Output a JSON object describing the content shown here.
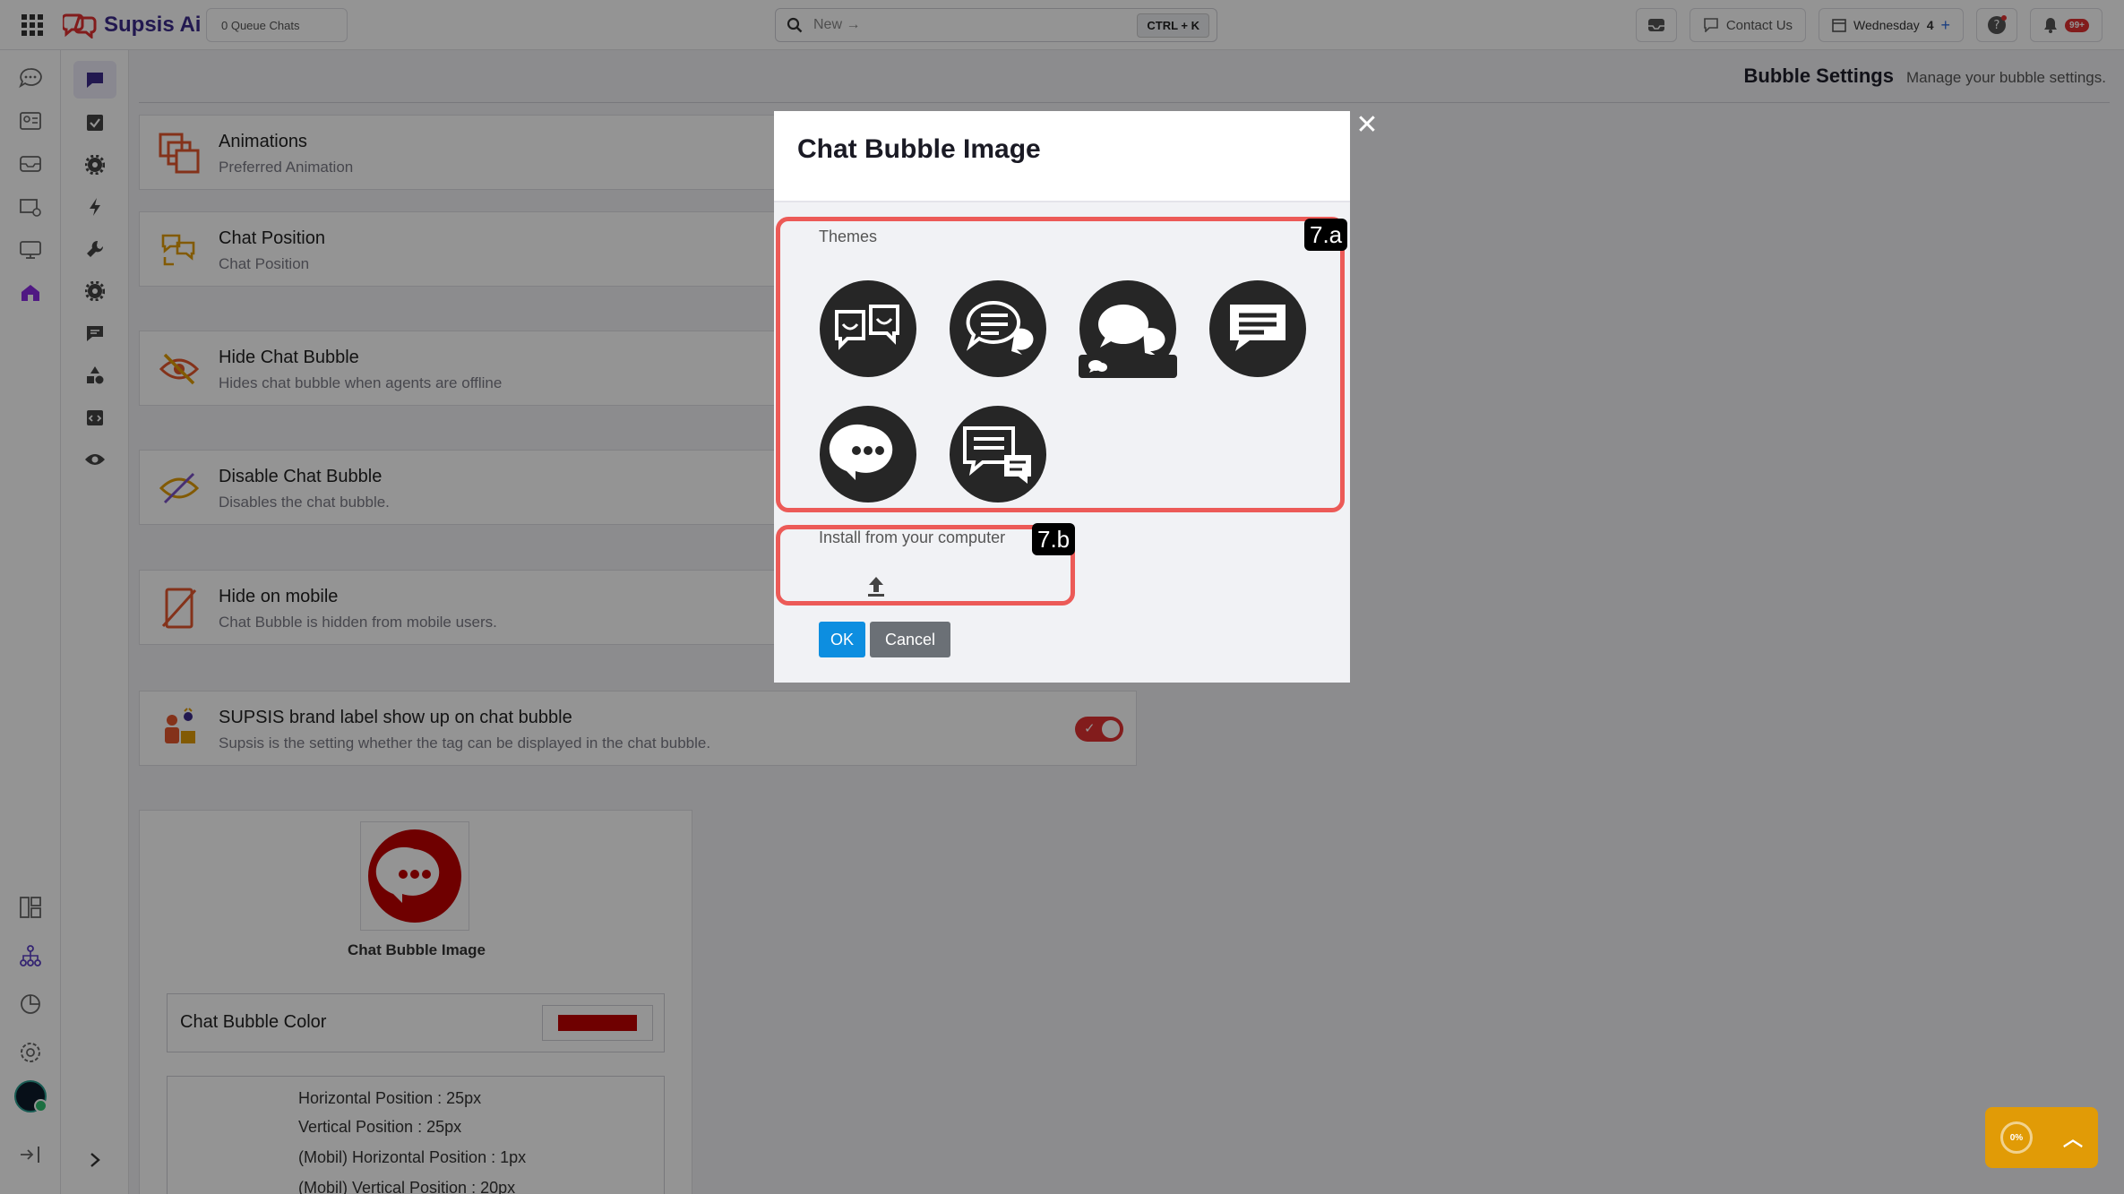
{
  "app": {
    "brand": "Supsis Ai",
    "queue": "0 Queue Chats"
  },
  "search": {
    "placeholder": "New →",
    "shortcut": "CTRL + K"
  },
  "topbar": {
    "contact": "Contact Us",
    "day": "Wednesday",
    "day_num": "4",
    "notif_count": "99+"
  },
  "page": {
    "title": "Bubble Settings",
    "subtitle": "Manage your bubble settings."
  },
  "settings": [
    {
      "title": "Animations",
      "desc": "Preferred Animation",
      "icon": "animation-icon"
    },
    {
      "title": "Chat Position",
      "desc": "Chat Position",
      "icon": "position-icon"
    },
    {
      "title": "Hide Chat Bubble",
      "desc": "Hides chat bubble when agents are offline",
      "icon": "eye-off-icon"
    },
    {
      "title": "Disable Chat Bubble",
      "desc": "Disables the chat bubble.",
      "icon": "disable-icon"
    },
    {
      "title": "Hide on mobile",
      "desc": "Chat Bubble is hidden from mobile users.",
      "icon": "mobile-off-icon"
    },
    {
      "title": "SUPSIS brand label show up on chat bubble",
      "desc": "Supsis is the setting whether the tag can be displayed in the chat bubble.",
      "icon": "brand-icon",
      "toggle_on": true
    }
  ],
  "bubble": {
    "image_caption": "Chat Bubble Image",
    "color_label": "Chat Bubble Color",
    "color": "#c00000",
    "positions": [
      "Horizontal Position : 25px",
      "Vertical Position : 25px",
      "(Mobil) Horizontal Position : 1px",
      "(Mobil) Vertical Position : 20px"
    ]
  },
  "modal": {
    "title": "Chat Bubble Image",
    "themes_label": "Themes",
    "install_label": "Install from your computer",
    "tag_a": "7.a",
    "tag_b": "7.b",
    "ok": "OK",
    "cancel": "Cancel"
  },
  "widget": {
    "percent": "0%"
  },
  "colors": {
    "accent": "#3b2a8a",
    "danger": "#e03131",
    "primary": "#0d8ee0",
    "highlight": "#ec5a57",
    "widget": "#e19b06"
  }
}
